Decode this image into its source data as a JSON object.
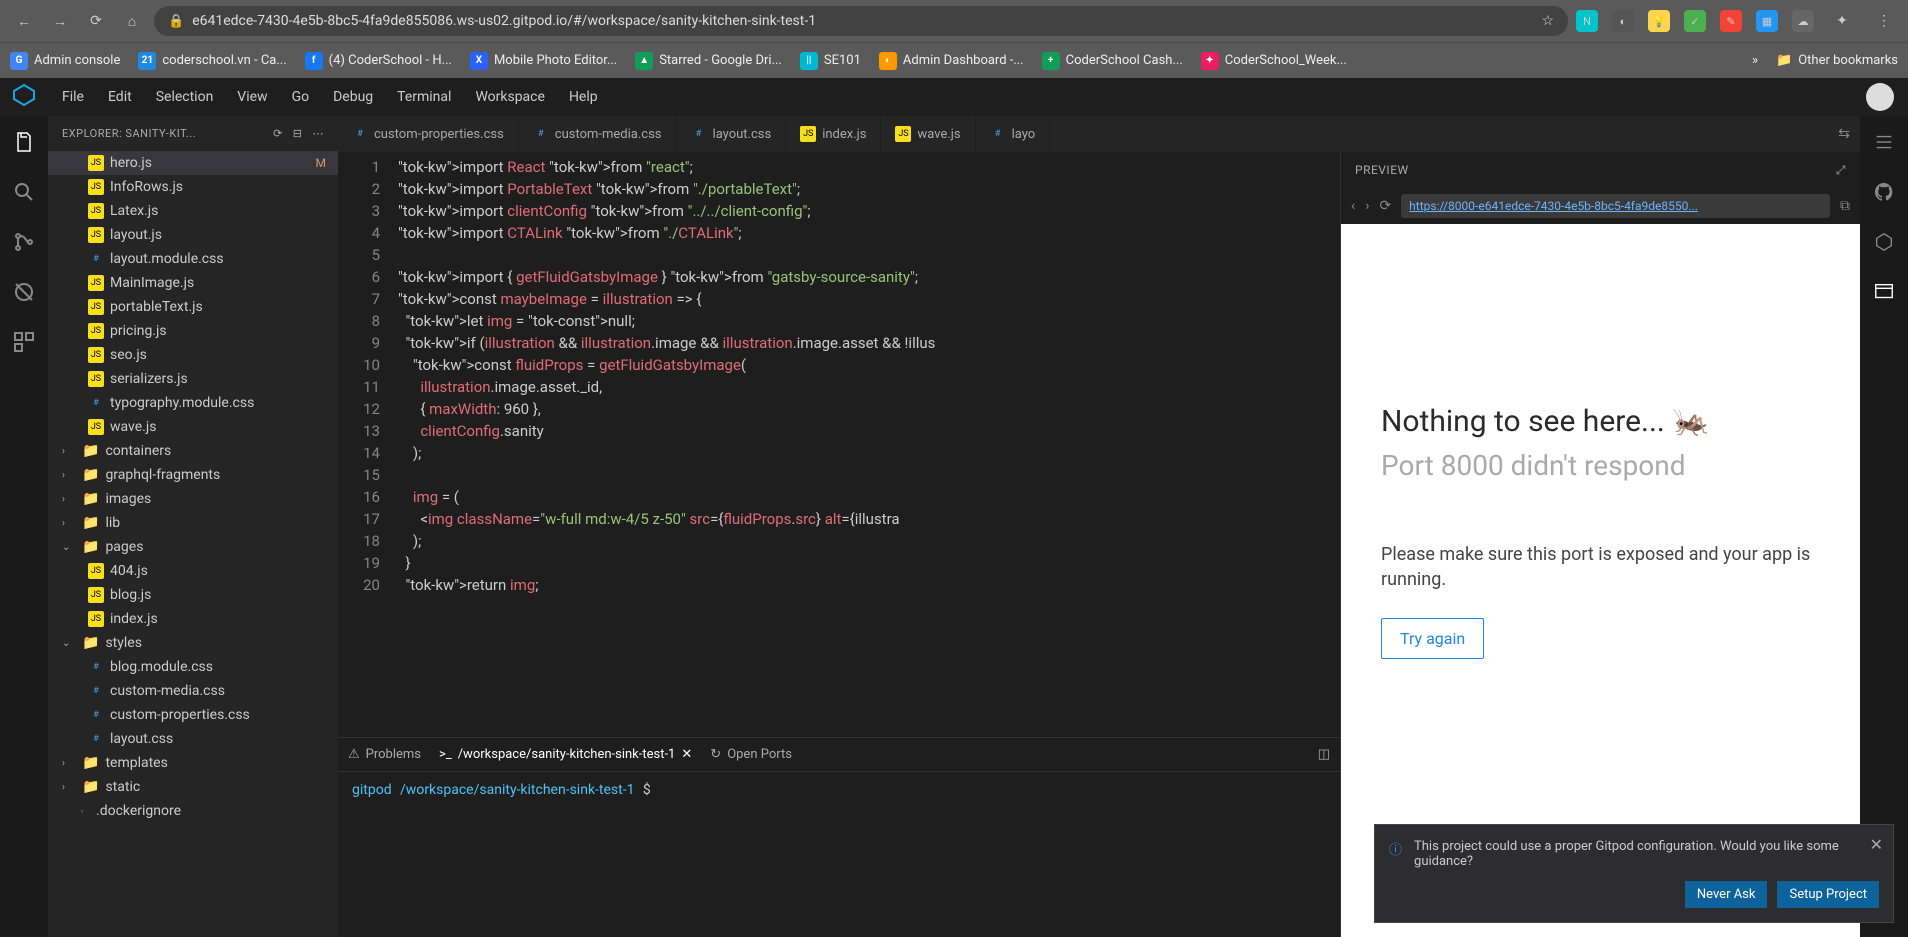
{
  "browser": {
    "url": "e641edce-7430-4e5b-8bc5-4fa9de855086.ws-us02.gitpod.io/#/workspace/sanity-kitchen-sink-test-1",
    "bookmarks": [
      {
        "label": "Admin console",
        "icon": "G",
        "color": "#4285f4"
      },
      {
        "label": "coderschool.vn - Ca...",
        "icon": "21",
        "color": "#1e88e5"
      },
      {
        "label": "(4) CoderSchool - H...",
        "icon": "f",
        "color": "#1877f2"
      },
      {
        "label": "Mobile Photo Editor...",
        "icon": "X",
        "color": "#2962ff"
      },
      {
        "label": "Starred - Google Dri...",
        "icon": "▲",
        "color": "#0f9d58"
      },
      {
        "label": "SE101",
        "icon": "||",
        "color": "#00b8d4"
      },
      {
        "label": "Admin Dashboard -...",
        "icon": "◐",
        "color": "#ff9800"
      },
      {
        "label": "CoderSchool Cash...",
        "icon": "+",
        "color": "#0f9d58"
      },
      {
        "label": "CoderSchool_Week...",
        "icon": "✦",
        "color": "#e91e63"
      }
    ],
    "other_bookmarks": "Other bookmarks"
  },
  "menus": [
    "File",
    "Edit",
    "Selection",
    "View",
    "Go",
    "Debug",
    "Terminal",
    "Workspace",
    "Help"
  ],
  "explorer": {
    "title": "EXPLORER: SANITY-KIT...",
    "files": [
      {
        "name": "hero.js",
        "type": "js",
        "depth": 2,
        "selected": true,
        "badge": "M"
      },
      {
        "name": "InfoRows.js",
        "type": "js",
        "depth": 2
      },
      {
        "name": "Latex.js",
        "type": "js",
        "depth": 2
      },
      {
        "name": "layout.js",
        "type": "js",
        "depth": 2
      },
      {
        "name": "layout.module.css",
        "type": "css",
        "depth": 2
      },
      {
        "name": "MainImage.js",
        "type": "js",
        "depth": 2
      },
      {
        "name": "portableText.js",
        "type": "js",
        "depth": 2
      },
      {
        "name": "pricing.js",
        "type": "js",
        "depth": 2
      },
      {
        "name": "seo.js",
        "type": "js",
        "depth": 2
      },
      {
        "name": "serializers.js",
        "type": "js",
        "depth": 2
      },
      {
        "name": "typography.module.css",
        "type": "css",
        "depth": 2
      },
      {
        "name": "wave.js",
        "type": "js",
        "depth": 2
      },
      {
        "name": "containers",
        "type": "folder",
        "depth": 1,
        "chev": "›"
      },
      {
        "name": "graphql-fragments",
        "type": "folder",
        "depth": 1,
        "chev": "›"
      },
      {
        "name": "images",
        "type": "folder",
        "depth": 1,
        "chev": "›"
      },
      {
        "name": "lib",
        "type": "folder",
        "depth": 1,
        "chev": "›"
      },
      {
        "name": "pages",
        "type": "folder",
        "depth": 1,
        "chev": "⌄"
      },
      {
        "name": "404.js",
        "type": "js",
        "depth": 2
      },
      {
        "name": "blog.js",
        "type": "js",
        "depth": 2
      },
      {
        "name": "index.js",
        "type": "js",
        "depth": 2
      },
      {
        "name": "styles",
        "type": "folder",
        "depth": 1,
        "chev": "⌄"
      },
      {
        "name": "blog.module.css",
        "type": "css",
        "depth": 2
      },
      {
        "name": "custom-media.css",
        "type": "css",
        "depth": 2
      },
      {
        "name": "custom-properties.css",
        "type": "css",
        "depth": 2
      },
      {
        "name": "layout.css",
        "type": "css",
        "depth": 2
      },
      {
        "name": "templates",
        "type": "folder",
        "depth": 1,
        "chev": "›"
      },
      {
        "name": "static",
        "type": "folder",
        "depth": 1,
        "chev": "›"
      },
      {
        "name": ".dockerignore",
        "type": "file",
        "depth": 1
      }
    ]
  },
  "tabs": [
    {
      "label": "custom-properties.css",
      "icon": "css"
    },
    {
      "label": "custom-media.css",
      "icon": "css"
    },
    {
      "label": "layout.css",
      "icon": "css"
    },
    {
      "label": "index.js",
      "icon": "js"
    },
    {
      "label": "wave.js",
      "icon": "js"
    },
    {
      "label": "layo",
      "icon": "css"
    }
  ],
  "code_lines": [
    "import React from \"react\";",
    "import PortableText from \"./portableText\";",
    "import clientConfig from \"../../client-config\";",
    "import CTALink from \"./CTALink\";",
    "",
    "import { getFluidGatsbyImage } from \"gatsby-source-sanity\";",
    "const maybeImage = illustration => {",
    "  let img = null;",
    "  if (illustration && illustration.image && illustration.image.asset && !illus",
    "    const fluidProps = getFluidGatsbyImage(",
    "      illustration.image.asset._id,",
    "      { maxWidth: 960 },",
    "      clientConfig.sanity",
    "    );",
    "",
    "    img = (",
    "      <img className=\"w-full md:w-4/5 z-50\" src={fluidProps.src} alt={illustra",
    "    );",
    "  }",
    "  return img;"
  ],
  "terminal": {
    "tabs": [
      {
        "label": "Problems",
        "icon": "⚠"
      },
      {
        "label": "/workspace/sanity-kitchen-sink-test-1",
        "icon": ">_",
        "active": true,
        "closable": true
      },
      {
        "label": "Open Ports",
        "icon": "↻"
      }
    ],
    "prompt_user": "gitpod",
    "prompt_path": "/workspace/sanity-kitchen-sink-test-1",
    "prompt_sym": "$"
  },
  "preview": {
    "header": "PREVIEW",
    "url": "https://8000-e641edce-7430-4e5b-8bc5-4fa9de8550...",
    "title": "Nothing to see here... 🦗",
    "subtitle": "Port 8000 didn't respond",
    "body": "Please make sure this port is exposed and your app is running.",
    "button": "Try again"
  },
  "toast": {
    "message": "This project could use a proper Gitpod configuration. Would you like some guidance?",
    "never": "Never Ask",
    "setup": "Setup Project"
  }
}
